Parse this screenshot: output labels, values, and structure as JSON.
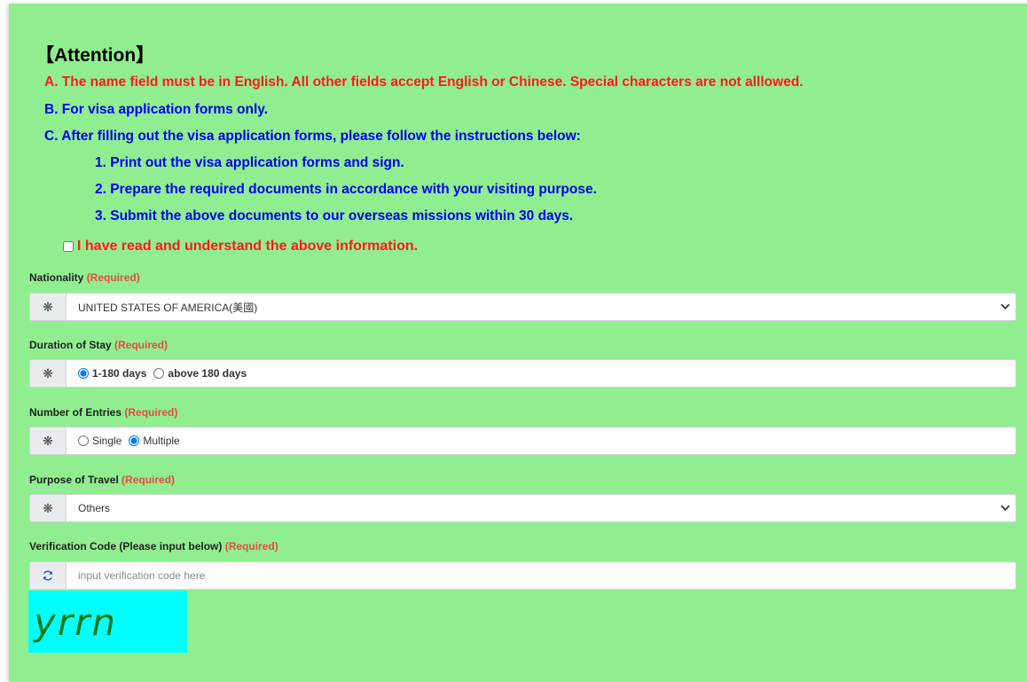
{
  "attention": {
    "title": "【Attention】",
    "line_a": "A. The name field must be in English. All other fields accept English or Chinese. Special characters are not alllowed.",
    "line_b": "B. For visa application forms only.",
    "line_c": "C. After filling out the visa application forms, please follow the instructions below:",
    "steps": [
      "1. Print out the visa application forms and sign.",
      "2. Prepare the required documents in accordance with your visiting purpose.",
      "3. Submit the above documents to our overseas missions within 30 days."
    ],
    "acknowledge": "I have read and understand the above information.",
    "acknowledge_checked": false
  },
  "required_text": "(Required)",
  "nationality": {
    "label": "Nationality",
    "value": "UNITED STATES OF AMERICA(美國)"
  },
  "duration": {
    "label": "Duration of Stay",
    "options": [
      "1-180 days",
      "above 180 days"
    ],
    "selected": "1-180 days"
  },
  "entries": {
    "label": "Number of Entries",
    "options": [
      "Single",
      "Multiple"
    ],
    "selected": "Multiple"
  },
  "purpose": {
    "label": "Purpose of Travel",
    "value": "Others"
  },
  "verification": {
    "label": "Verification Code (Please input below)",
    "placeholder": "input verification code here",
    "value": "",
    "captcha_text": "yrrn"
  },
  "icons": {
    "required_marker": "asterisk-icon",
    "refresh": "refresh-icon",
    "dropdown": "chevron-down-icon"
  },
  "colors": {
    "panel_bg": "#90ee90",
    "warning_red": "#ff1a1a",
    "info_blue": "#0000ee",
    "required_red": "#e74c3c",
    "captcha_bg": "#00ffff",
    "captcha_text": "#0f7a17"
  }
}
